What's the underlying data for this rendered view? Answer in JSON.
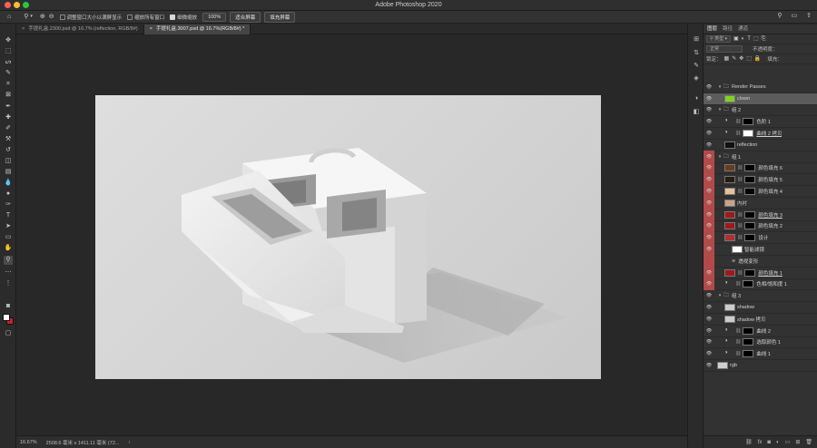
{
  "app": {
    "title": "Adobe Photoshop 2020"
  },
  "options_bar": {
    "zoom_tool_icon": "magnifier-icon",
    "resize_windows_label": "调整窗口大小以满屏显示",
    "zoom_all_windows_label": "缩放所有窗口",
    "scrubby_zoom_label": "细微缩放",
    "zoom_percent_button": "100%",
    "fit_screen_button": "适合屏幕",
    "fill_screen_button": "填充屏幕"
  },
  "tabs": [
    {
      "label": "手提礼盒.2300.psd @ 16.7% (reflection, RGB/8#)",
      "active": false
    },
    {
      "label": "手提礼盒.3007.psd @ 16.7%(RGB/8#) *",
      "active": true
    }
  ],
  "status": {
    "zoom": "16.67%",
    "doc_size": "2508.6 毫米 x 1411.11 毫米 (72..."
  },
  "panel": {
    "tabs": [
      "图层",
      "路径",
      "通道"
    ],
    "kind_label": "类型",
    "blend_mode": "正常",
    "opacity_label": "不透明度：",
    "lock_label": "锁定：",
    "fill_label": "填充："
  },
  "layers": [
    {
      "name": "Render Passes",
      "type": "group",
      "indent": 0,
      "red": false,
      "sel": false,
      "ul": false,
      "thumb": ""
    },
    {
      "name": "clown",
      "type": "layer",
      "indent": 1,
      "red": false,
      "sel": true,
      "ul": false,
      "thumb": "#7ed321"
    },
    {
      "name": "组 2",
      "type": "group",
      "indent": 0,
      "red": false,
      "sel": false,
      "ul": false,
      "thumb": ""
    },
    {
      "name": "色阶 1",
      "type": "adj",
      "indent": 1,
      "red": false,
      "sel": false,
      "ul": false,
      "thumb": ""
    },
    {
      "name": "曲线 2 拷贝",
      "type": "adj",
      "indent": 1,
      "red": false,
      "sel": false,
      "ul": true,
      "thumb": "#bbbbbb"
    },
    {
      "name": "reflection",
      "type": "layer",
      "indent": 1,
      "red": false,
      "sel": false,
      "ul": false,
      "thumb": "#111111"
    },
    {
      "name": "组 1",
      "type": "group",
      "indent": 0,
      "red": true,
      "sel": false,
      "ul": false,
      "thumb": ""
    },
    {
      "name": "颜色填充 6",
      "type": "fill",
      "indent": 1,
      "red": true,
      "sel": false,
      "ul": false,
      "thumb": "#6b3a1f"
    },
    {
      "name": "颜色填充 5",
      "type": "fill",
      "indent": 1,
      "red": true,
      "sel": false,
      "ul": false,
      "thumb": "#2a1a10"
    },
    {
      "name": "颜色填充 4",
      "type": "fill",
      "indent": 1,
      "red": true,
      "sel": false,
      "ul": false,
      "thumb": "#e8c19a"
    },
    {
      "name": "内衬",
      "type": "layer",
      "indent": 1,
      "red": true,
      "sel": false,
      "ul": false,
      "thumb": "#c8a58a"
    },
    {
      "name": "颜色填充 3",
      "type": "fill",
      "indent": 1,
      "red": true,
      "sel": false,
      "ul": true,
      "thumb": "#a01818"
    },
    {
      "name": "颜色填充 2",
      "type": "fill",
      "indent": 1,
      "red": true,
      "sel": false,
      "ul": false,
      "thumb": "#a01818"
    },
    {
      "name": "设计",
      "type": "smart",
      "indent": 1,
      "red": true,
      "sel": false,
      "ul": false,
      "thumb": "#b03030"
    },
    {
      "name": "智能滤镜",
      "type": "sub",
      "indent": 2,
      "red": true,
      "sel": false,
      "ul": false,
      "thumb": "#ffffff"
    },
    {
      "name": "透视变形",
      "type": "sub",
      "indent": 2,
      "red": true,
      "sel": false,
      "ul": false,
      "thumb": ""
    },
    {
      "name": "颜色填充 1",
      "type": "fill",
      "indent": 1,
      "red": true,
      "sel": false,
      "ul": true,
      "thumb": "#a01818"
    },
    {
      "name": "色相/饱和度 1",
      "type": "adj",
      "indent": 1,
      "red": true,
      "sel": false,
      "ul": false,
      "thumb": ""
    },
    {
      "name": "组 3",
      "type": "group",
      "indent": 0,
      "red": false,
      "sel": false,
      "ul": false,
      "thumb": ""
    },
    {
      "name": "shadow",
      "type": "layer",
      "indent": 1,
      "red": false,
      "sel": false,
      "ul": false,
      "thumb": "#cccccc"
    },
    {
      "name": "shadow 拷贝",
      "type": "layer",
      "indent": 1,
      "red": false,
      "sel": false,
      "ul": false,
      "thumb": "#cccccc"
    },
    {
      "name": "曲线 2",
      "type": "adj",
      "indent": 1,
      "red": false,
      "sel": false,
      "ul": false,
      "thumb": ""
    },
    {
      "name": "选取颜色 1",
      "type": "adj",
      "indent": 1,
      "red": false,
      "sel": false,
      "ul": false,
      "thumb": ""
    },
    {
      "name": "曲线 1",
      "type": "adj",
      "indent": 1,
      "red": false,
      "sel": false,
      "ul": false,
      "thumb": ""
    },
    {
      "name": "rgb",
      "type": "layer",
      "indent": 0,
      "red": false,
      "sel": false,
      "ul": false,
      "thumb": "#cfcfcf"
    }
  ]
}
